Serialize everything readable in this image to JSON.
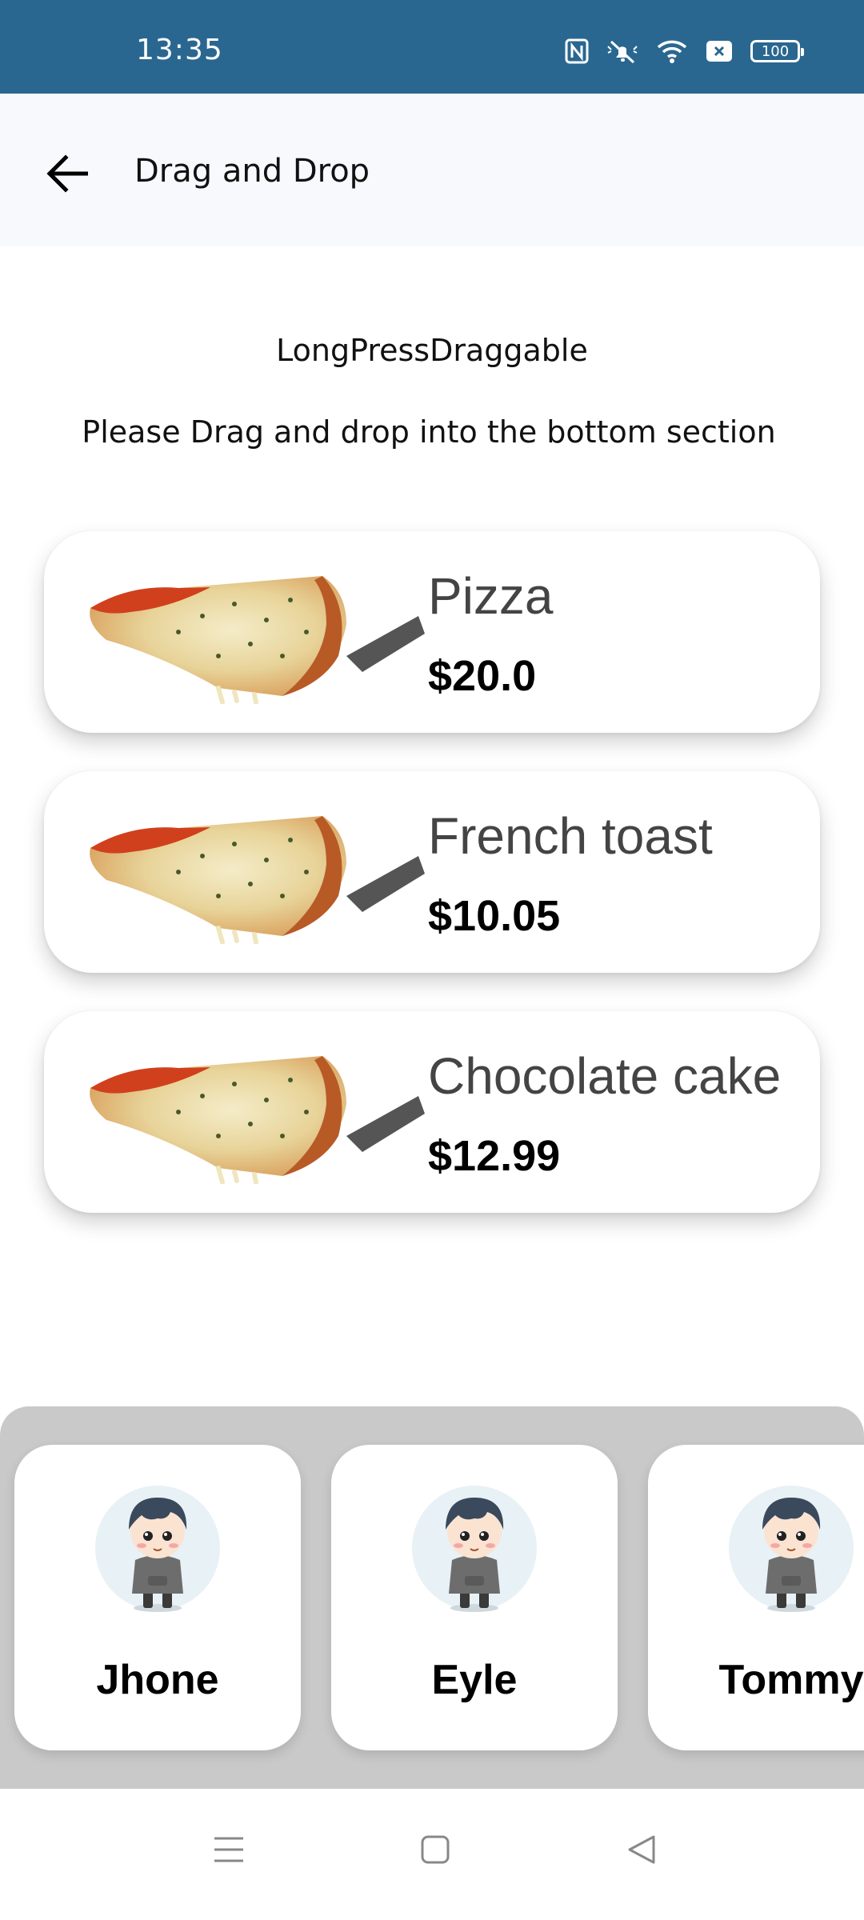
{
  "status_bar": {
    "time": "13:35",
    "battery": "100",
    "icons": [
      "nfc-icon",
      "mute-icon",
      "wifi-icon",
      "close-box-icon",
      "battery-icon"
    ],
    "background": "#2a6790"
  },
  "app_bar": {
    "title": "Drag and Drop",
    "back_icon": "arrow-back-icon",
    "background": "#f7f9fc"
  },
  "main": {
    "heading": "LongPressDraggable",
    "instruction": "Please Drag and drop into the bottom section",
    "items": [
      {
        "name": "Pizza",
        "price": "$20.0"
      },
      {
        "name": "French toast",
        "price": "$10.05"
      },
      {
        "name": "Chocolate cake",
        "price": "$12.99"
      }
    ]
  },
  "drop_zone": {
    "background": "#c9c9c9",
    "customers": [
      {
        "name": "Jhone"
      },
      {
        "name": "Eyle"
      },
      {
        "name": "Tommy"
      }
    ]
  },
  "nav_bar": {
    "icons": [
      "menu-icon",
      "home-icon",
      "back-icon"
    ]
  }
}
